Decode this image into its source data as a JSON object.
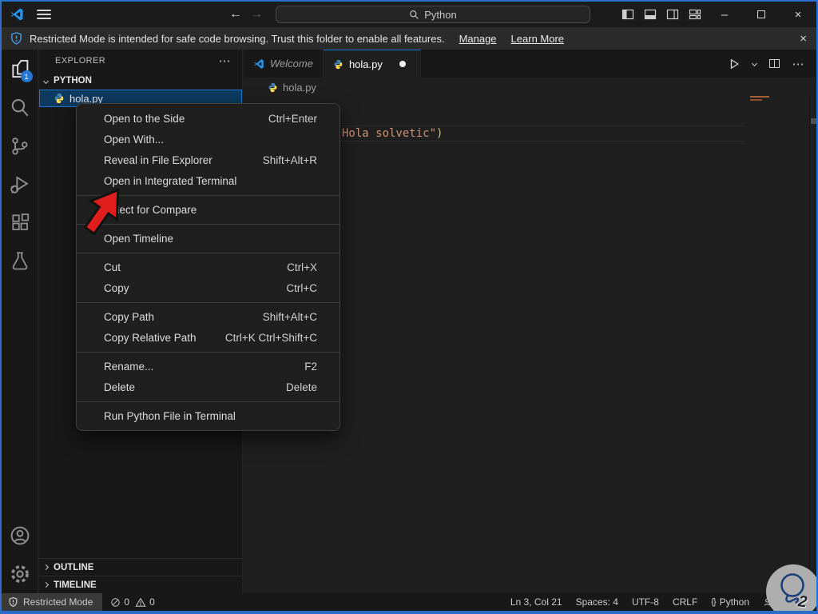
{
  "colors": {
    "accent_border": "#2a70cd",
    "tab_accent": "#0c7ad8",
    "selection_bg": "#0e3a5f",
    "selection_border": "#2475c9",
    "badge": "#2478d4",
    "arrow_red": "#e01e1e",
    "string_orange": "#ce9178",
    "banner_shield_blue": "#4aa0f0"
  },
  "titlebar": {
    "search_value": "Python"
  },
  "icons": {
    "back": "←",
    "forward": "→",
    "more": "⋯",
    "minimize": "–",
    "close": "×"
  },
  "banner": {
    "message": "Restricted Mode is intended for safe code browsing. Trust this folder to enable all features.",
    "manage": "Manage",
    "learn_more": "Learn More",
    "close": "×"
  },
  "activitybar": {
    "explorer_badge": "1"
  },
  "sidebar": {
    "title": "EXPLORER",
    "more": "⋯",
    "section": "PYTHON",
    "file": "hola.py",
    "outline": "OUTLINE",
    "timeline": "TIMELINE"
  },
  "tabs": {
    "welcome": "Welcome",
    "active": "hola.py",
    "more": "⋯"
  },
  "breadcrumb": {
    "file": "hola.py"
  },
  "editor": {
    "code_string": "Hola solvetic\"",
    "code_bracket": ")"
  },
  "context_menu": {
    "items": [
      {
        "label": "Open to the Side",
        "shortcut": "Ctrl+Enter"
      },
      {
        "label": "Open With...",
        "shortcut": ""
      },
      {
        "label": "Reveal in File Explorer",
        "shortcut": "Shift+Alt+R"
      },
      {
        "label": "Open in Integrated Terminal",
        "shortcut": ""
      },
      {
        "label": "Select for Compare",
        "shortcut": ""
      },
      {
        "label": "Open Timeline",
        "shortcut": ""
      },
      {
        "label": "Cut",
        "shortcut": "Ctrl+X"
      },
      {
        "label": "Copy",
        "shortcut": "Ctrl+C"
      },
      {
        "label": "Copy Path",
        "shortcut": "Shift+Alt+C"
      },
      {
        "label": "Copy Relative Path",
        "shortcut": "Ctrl+K Ctrl+Shift+C"
      },
      {
        "label": "Rename...",
        "shortcut": "F2"
      },
      {
        "label": "Delete",
        "shortcut": "Delete"
      },
      {
        "label": "Run Python File in Terminal",
        "shortcut": ""
      }
    ]
  },
  "statusbar": {
    "restricted": "Restricted Mode",
    "errors": "0",
    "warnings": "0",
    "cursor": "Ln 3, Col 21",
    "indent": "Spaces: 4",
    "encoding": "UTF-8",
    "eol": "CRLF",
    "braces": "{}",
    "language": "Python"
  }
}
